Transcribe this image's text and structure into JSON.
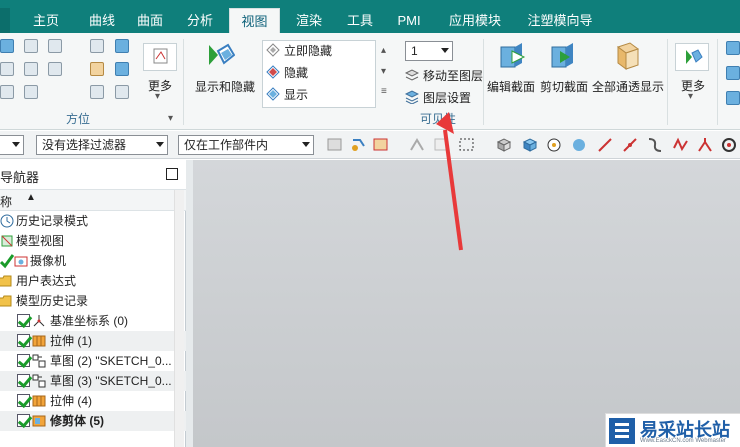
{
  "tabs": [
    {
      "label": "主页"
    },
    {
      "label": "曲线"
    },
    {
      "label": "曲面"
    },
    {
      "label": "分析"
    },
    {
      "label": "视图",
      "active": true
    },
    {
      "label": "渲染"
    },
    {
      "label": "工具"
    },
    {
      "label": "PMI"
    },
    {
      "label": "应用模块"
    },
    {
      "label": "注塑模向导"
    }
  ],
  "ribbon": {
    "orientation_group": {
      "label": "方位",
      "more": "更多"
    },
    "show_hide": {
      "label": "显示和隐藏"
    },
    "visibility_list": [
      "立即隐藏",
      "隐藏",
      "显示"
    ],
    "layer_dropdown_value": "1",
    "move_to_layer": "移动至图层",
    "layer_settings": "图层设置",
    "visibility_group": "可见性",
    "edit_section": "编辑截面",
    "clip_section": "剪切截面",
    "show_all_pass": "全部通透显示",
    "more2": "更多"
  },
  "toolbar2": {
    "selection_filter": "没有选择过滤器",
    "scope": "仅在工作部件内"
  },
  "navigator": {
    "title": "导航器",
    "column": "称",
    "items": [
      {
        "label": "历史记录模式",
        "indent": 0,
        "icon": "clock-icon"
      },
      {
        "label": "模型视图",
        "indent": 0,
        "icon": "model-view-icon"
      },
      {
        "label": "摄像机",
        "indent": 1,
        "icon": "camera-icon"
      },
      {
        "label": "用户表达式",
        "indent": 0,
        "icon": "folder-icon"
      },
      {
        "label": "模型历史记录",
        "indent": 0,
        "icon": "folder-icon"
      },
      {
        "label": "基准坐标系 (0)",
        "indent": 2,
        "icon": "csys-icon"
      },
      {
        "label": "拉伸 (1)",
        "indent": 2,
        "icon": "extrude-icon"
      },
      {
        "label": "草图 (2) \"SKETCH_0...",
        "indent": 2,
        "icon": "sketch-icon"
      },
      {
        "label": "草图 (3) \"SKETCH_0...",
        "indent": 2,
        "icon": "sketch-icon"
      },
      {
        "label": "拉伸 (4)",
        "indent": 2,
        "icon": "extrude-icon"
      },
      {
        "label": "修剪体 (5)",
        "indent": 2,
        "icon": "trim-body-icon",
        "bold": true
      }
    ]
  },
  "watermark": {
    "title": "易采站长站",
    "sub": "Www.EasckCN.com  Webmaster"
  },
  "colors": {
    "tab_bar": "#0f7f7b",
    "canvas": "#c8cbce",
    "arrow": "#e8393a"
  }
}
